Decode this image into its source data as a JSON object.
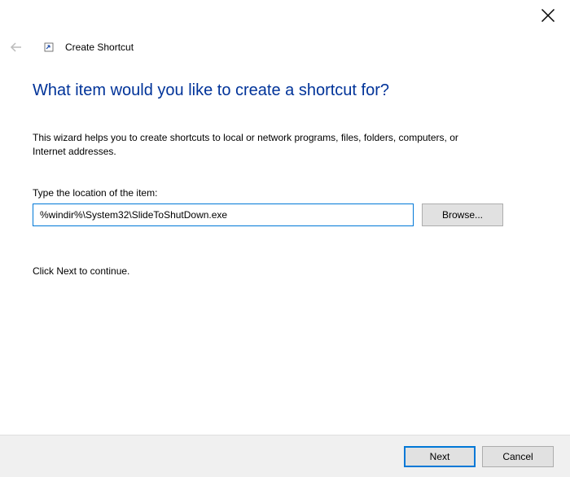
{
  "window": {
    "title": "Create Shortcut"
  },
  "content": {
    "heading": "What item would you like to create a shortcut for?",
    "description": "This wizard helps you to create shortcuts to local or network programs, files, folders, computers, or Internet addresses.",
    "input_label": "Type the location of the item:",
    "input_value": "%windir%\\System32\\SlideToShutDown.exe",
    "browse_label": "Browse...",
    "continue_text": "Click Next to continue."
  },
  "footer": {
    "next_label": "Next",
    "cancel_label": "Cancel"
  }
}
